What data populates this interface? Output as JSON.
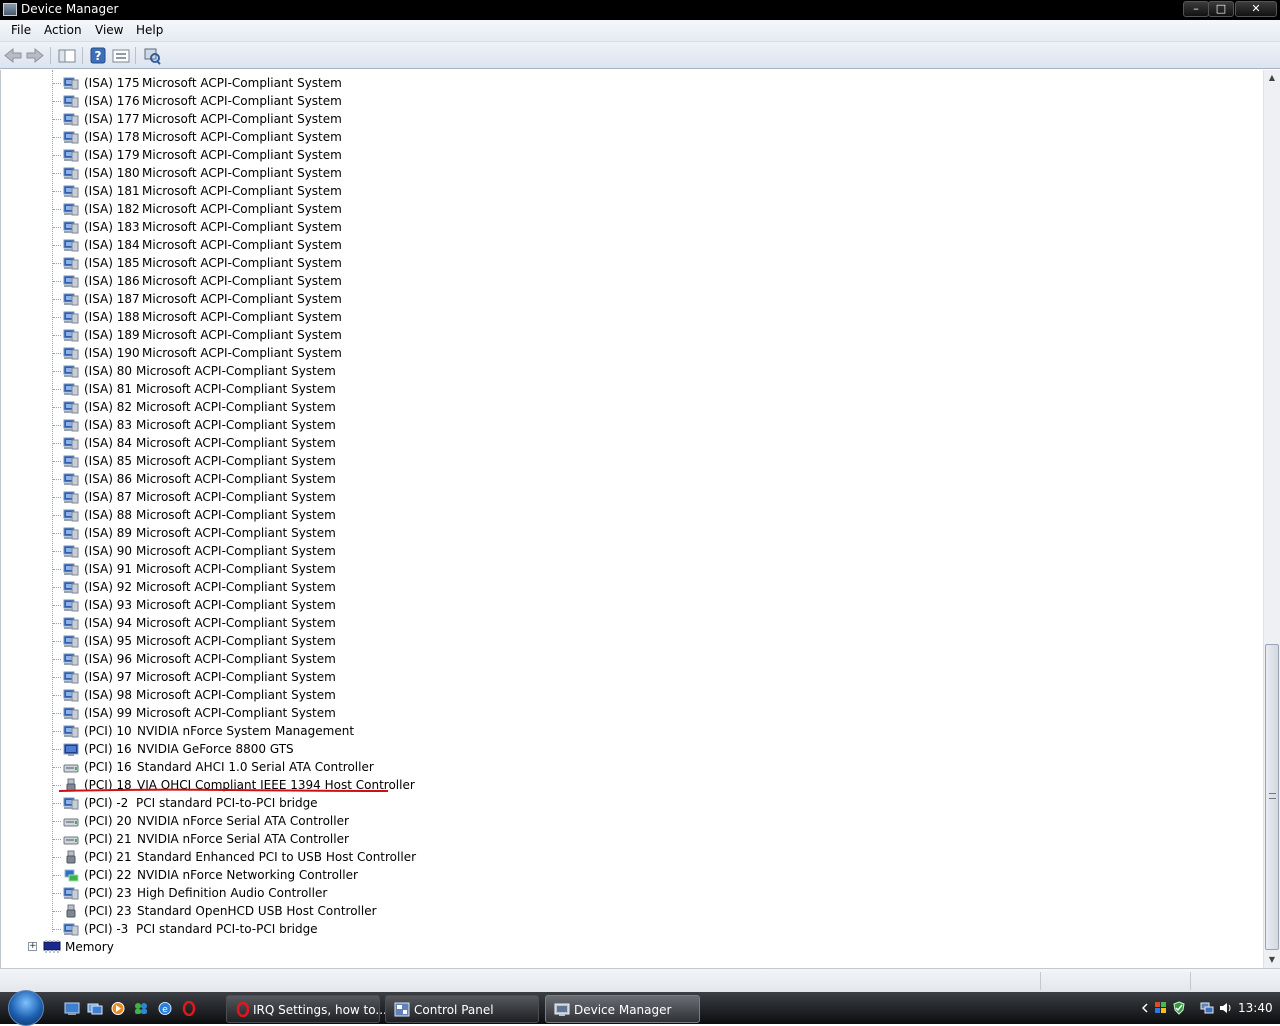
{
  "window": {
    "title": "Device Manager"
  },
  "menu": [
    "File",
    "Action",
    "View",
    "Help"
  ],
  "tree_rows": [
    {
      "irq": "(ISA) 175",
      "name": "Microsoft ACPI-Compliant System",
      "icon": "system-device-icon"
    },
    {
      "irq": "(ISA) 176",
      "name": "Microsoft ACPI-Compliant System",
      "icon": "system-device-icon"
    },
    {
      "irq": "(ISA) 177",
      "name": "Microsoft ACPI-Compliant System",
      "icon": "system-device-icon"
    },
    {
      "irq": "(ISA) 178",
      "name": "Microsoft ACPI-Compliant System",
      "icon": "system-device-icon"
    },
    {
      "irq": "(ISA) 179",
      "name": "Microsoft ACPI-Compliant System",
      "icon": "system-device-icon"
    },
    {
      "irq": "(ISA) 180",
      "name": "Microsoft ACPI-Compliant System",
      "icon": "system-device-icon"
    },
    {
      "irq": "(ISA) 181",
      "name": "Microsoft ACPI-Compliant System",
      "icon": "system-device-icon"
    },
    {
      "irq": "(ISA) 182",
      "name": "Microsoft ACPI-Compliant System",
      "icon": "system-device-icon"
    },
    {
      "irq": "(ISA) 183",
      "name": "Microsoft ACPI-Compliant System",
      "icon": "system-device-icon"
    },
    {
      "irq": "(ISA) 184",
      "name": "Microsoft ACPI-Compliant System",
      "icon": "system-device-icon"
    },
    {
      "irq": "(ISA) 185",
      "name": "Microsoft ACPI-Compliant System",
      "icon": "system-device-icon"
    },
    {
      "irq": "(ISA) 186",
      "name": "Microsoft ACPI-Compliant System",
      "icon": "system-device-icon"
    },
    {
      "irq": "(ISA) 187",
      "name": "Microsoft ACPI-Compliant System",
      "icon": "system-device-icon"
    },
    {
      "irq": "(ISA) 188",
      "name": "Microsoft ACPI-Compliant System",
      "icon": "system-device-icon"
    },
    {
      "irq": "(ISA) 189",
      "name": "Microsoft ACPI-Compliant System",
      "icon": "system-device-icon"
    },
    {
      "irq": "(ISA) 190",
      "name": "Microsoft ACPI-Compliant System",
      "icon": "system-device-icon"
    },
    {
      "irq": "(ISA) 80",
      "name": "Microsoft ACPI-Compliant System",
      "icon": "system-device-icon"
    },
    {
      "irq": "(ISA) 81",
      "name": "Microsoft ACPI-Compliant System",
      "icon": "system-device-icon"
    },
    {
      "irq": "(ISA) 82",
      "name": "Microsoft ACPI-Compliant System",
      "icon": "system-device-icon"
    },
    {
      "irq": "(ISA) 83",
      "name": "Microsoft ACPI-Compliant System",
      "icon": "system-device-icon"
    },
    {
      "irq": "(ISA) 84",
      "name": "Microsoft ACPI-Compliant System",
      "icon": "system-device-icon"
    },
    {
      "irq": "(ISA) 85",
      "name": "Microsoft ACPI-Compliant System",
      "icon": "system-device-icon"
    },
    {
      "irq": "(ISA) 86",
      "name": "Microsoft ACPI-Compliant System",
      "icon": "system-device-icon"
    },
    {
      "irq": "(ISA) 87",
      "name": "Microsoft ACPI-Compliant System",
      "icon": "system-device-icon"
    },
    {
      "irq": "(ISA) 88",
      "name": "Microsoft ACPI-Compliant System",
      "icon": "system-device-icon"
    },
    {
      "irq": "(ISA) 89",
      "name": "Microsoft ACPI-Compliant System",
      "icon": "system-device-icon"
    },
    {
      "irq": "(ISA) 90",
      "name": "Microsoft ACPI-Compliant System",
      "icon": "system-device-icon"
    },
    {
      "irq": "(ISA) 91",
      "name": "Microsoft ACPI-Compliant System",
      "icon": "system-device-icon"
    },
    {
      "irq": "(ISA) 92",
      "name": "Microsoft ACPI-Compliant System",
      "icon": "system-device-icon"
    },
    {
      "irq": "(ISA) 93",
      "name": "Microsoft ACPI-Compliant System",
      "icon": "system-device-icon"
    },
    {
      "irq": "(ISA) 94",
      "name": "Microsoft ACPI-Compliant System",
      "icon": "system-device-icon"
    },
    {
      "irq": "(ISA) 95",
      "name": "Microsoft ACPI-Compliant System",
      "icon": "system-device-icon"
    },
    {
      "irq": "(ISA) 96",
      "name": "Microsoft ACPI-Compliant System",
      "icon": "system-device-icon"
    },
    {
      "irq": "(ISA) 97",
      "name": "Microsoft ACPI-Compliant System",
      "icon": "system-device-icon"
    },
    {
      "irq": "(ISA) 98",
      "name": "Microsoft ACPI-Compliant System",
      "icon": "system-device-icon"
    },
    {
      "irq": "(ISA) 99",
      "name": "Microsoft ACPI-Compliant System",
      "icon": "system-device-icon"
    },
    {
      "irq": "(PCI) 10",
      "name": "NVIDIA nForce System Management",
      "icon": "system-device-icon"
    },
    {
      "irq": "(PCI) 16",
      "name": "NVIDIA GeForce 8800 GTS",
      "icon": "display-adapter-icon"
    },
    {
      "irq": "(PCI) 16",
      "name": "Standard AHCI 1.0 Serial ATA Controller",
      "icon": "storage-controller-icon"
    },
    {
      "irq": "(PCI) 18",
      "name": "VIA OHCI Compliant IEEE 1394 Host Controller",
      "icon": "usb-plug-icon",
      "highlighted": true
    },
    {
      "irq": "(PCI) -2",
      "name": "PCI standard PCI-to-PCI bridge",
      "icon": "system-device-icon"
    },
    {
      "irq": "(PCI) 20",
      "name": "NVIDIA nForce Serial ATA Controller",
      "icon": "storage-controller-icon"
    },
    {
      "irq": "(PCI) 21",
      "name": "NVIDIA nForce Serial ATA Controller",
      "icon": "storage-controller-icon"
    },
    {
      "irq": "(PCI) 21",
      "name": "Standard Enhanced PCI to USB Host Controller",
      "icon": "usb-plug-icon"
    },
    {
      "irq": "(PCI) 22",
      "name": "NVIDIA nForce Networking Controller",
      "icon": "network-adapter-icon"
    },
    {
      "irq": "(PCI) 23",
      "name": "High Definition Audio Controller",
      "icon": "system-device-icon"
    },
    {
      "irq": "(PCI) 23",
      "name": "Standard OpenHCD USB Host Controller",
      "icon": "usb-plug-icon"
    },
    {
      "irq": "(PCI) -3",
      "name": "PCI standard PCI-to-PCI bridge",
      "icon": "system-device-icon"
    }
  ],
  "memory_node": {
    "label": "Memory",
    "expander": "+"
  },
  "scrollbar": {
    "position": 0.93
  },
  "taskbar": {
    "tasks": [
      {
        "label": "IRQ Settings, how to...",
        "icon": "opera-icon",
        "active": false
      },
      {
        "label": "Control Panel",
        "icon": "control-panel-icon",
        "active": false
      },
      {
        "label": "Device Manager",
        "icon": "device-manager-icon",
        "active": true
      }
    ],
    "clock": "13:40"
  },
  "colors": {
    "highlight_underline": "#d01010",
    "title_bar": "#000000"
  }
}
